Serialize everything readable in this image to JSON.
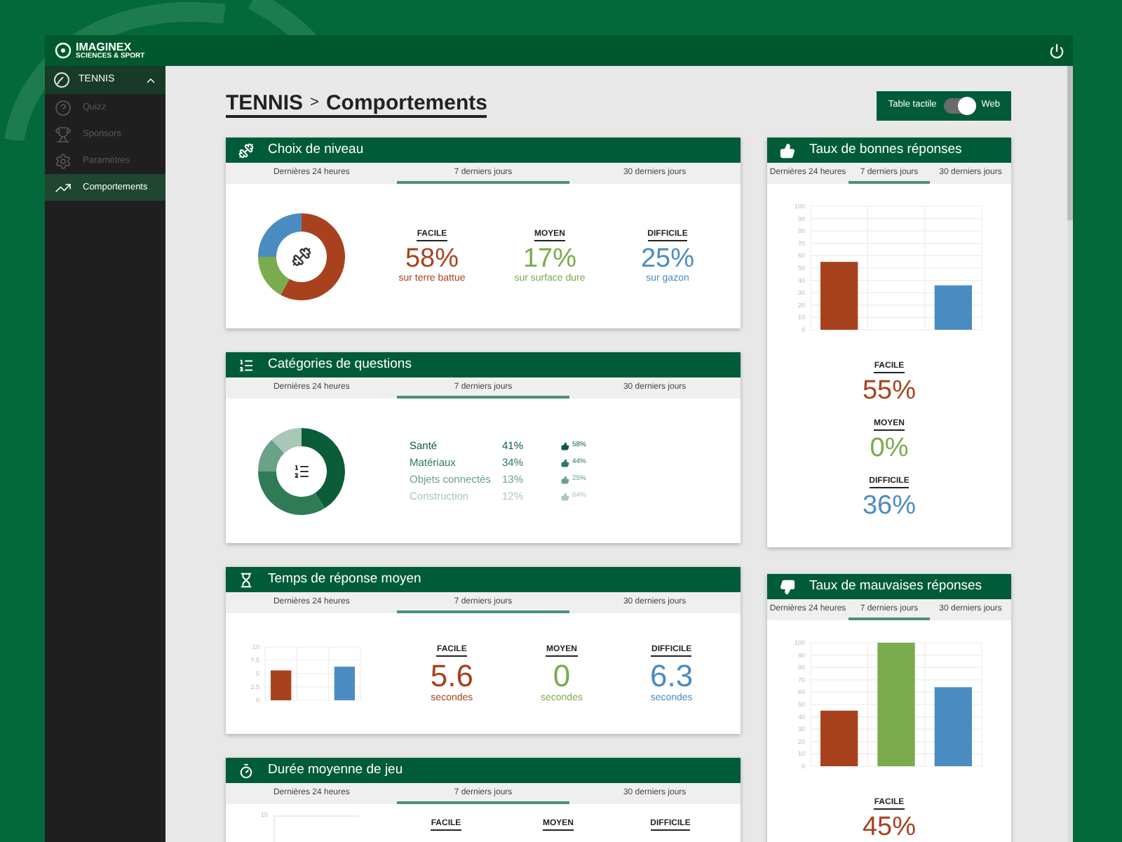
{
  "header": {
    "logo_name": "IMAGINEX",
    "logo_tagline": "SCIENCES & SPORT"
  },
  "sidebar": {
    "section": {
      "label": "TENNIS",
      "expanded": true
    },
    "items": [
      {
        "label": "Quizz",
        "selected": false
      },
      {
        "label": "Sponsors",
        "selected": false
      },
      {
        "label": "Paramètres",
        "selected": false
      },
      {
        "label": "Comportements",
        "selected": true
      }
    ]
  },
  "breadcrumb": {
    "section": "TENNIS",
    "separator": ">",
    "page": "Comportements"
  },
  "mode_toggle": {
    "left_label": "Table tactile",
    "right_label": "Web",
    "on": true
  },
  "left_cards": [
    {
      "kind": "levels_donut",
      "title": "Choix de niveau",
      "tabs": [
        {
          "label": "Dernières 24 heures",
          "selected": false
        },
        {
          "label": "7 derniers jours",
          "selected": true
        },
        {
          "label": "30 derniers jours",
          "selected": false
        }
      ],
      "chart_data": {
        "type": "donut",
        "values": [
          58,
          17,
          25
        ]
      },
      "stats": [
        {
          "label": "FACILE",
          "value": "58%",
          "caption": "sur terre battue",
          "color": "#a8421e"
        },
        {
          "label": "MOYEN",
          "value": "17%",
          "caption": "sur surface dure",
          "color": "#7aab4c"
        },
        {
          "label": "DIFFICILE",
          "value": "25%",
          "caption": "sur gazon",
          "color": "#4a8cc2"
        }
      ]
    },
    {
      "kind": "categories",
      "title": "Catégories de questions",
      "tabs": [
        {
          "label": "Dernières 24 heures",
          "selected": false
        },
        {
          "label": "7 derniers jours",
          "selected": true
        },
        {
          "label": "30 derniers jours",
          "selected": false
        }
      ],
      "chart_data": {
        "type": "donut",
        "values": [
          41,
          34,
          13,
          12
        ]
      },
      "items": [
        {
          "name": "Santé",
          "share": "41%",
          "success": "58%",
          "color": "#0b5c38"
        },
        {
          "name": "Matériaux",
          "share": "34%",
          "success": "44%",
          "color": "#2f7b57"
        },
        {
          "name": "Objets connectés",
          "share": "13%",
          "success": "25%",
          "color": "#6aa287"
        },
        {
          "name": "Construction",
          "share": "12%",
          "success": "64%",
          "color": "#a7c8b7"
        }
      ]
    },
    {
      "kind": "levels_bar",
      "title": "Temps de réponse moyen",
      "tabs": [
        {
          "label": "Dernières 24 heures",
          "selected": false
        },
        {
          "label": "7 derniers jours",
          "selected": true
        },
        {
          "label": "30 derniers jours",
          "selected": false
        }
      ],
      "chart_data": {
        "type": "bar",
        "values": [
          5.6,
          0,
          6.3
        ],
        "ylim": [
          0,
          10
        ],
        "yticks": [
          0,
          2.5,
          5,
          7.5,
          10
        ],
        "grid": true
      },
      "stats": [
        {
          "label": "FACILE",
          "value": "5.6",
          "caption": "secondes",
          "color": "#a8421e"
        },
        {
          "label": "MOYEN",
          "value": "0",
          "caption": "secondes",
          "color": "#7aab4c"
        },
        {
          "label": "DIFFICILE",
          "value": "6.3",
          "caption": "secondes",
          "color": "#4a8cc2"
        }
      ]
    },
    {
      "kind": "levels_partial",
      "title": "Durée moyenne de jeu",
      "tabs": [
        {
          "label": "Dernières 24 heures",
          "selected": false
        },
        {
          "label": "7 derniers jours",
          "selected": true
        },
        {
          "label": "30 derniers jours",
          "selected": false
        }
      ],
      "axis_label": "15",
      "stats": [
        {
          "label": "FACILE"
        },
        {
          "label": "MOYEN"
        },
        {
          "label": "DIFFICILE"
        }
      ]
    }
  ],
  "right_cards": [
    {
      "title": "Taux de bonnes réponses",
      "tabs": [
        {
          "label": "Dernières 24 heures",
          "selected": false
        },
        {
          "label": "7 derniers jours",
          "selected": true
        },
        {
          "label": "30 derniers jours",
          "selected": false
        }
      ],
      "chart_data": {
        "type": "bar",
        "values": [
          55,
          0,
          36
        ],
        "ylim": [
          0,
          100
        ],
        "yticks": [
          0,
          10,
          20,
          30,
          40,
          50,
          60,
          70,
          80,
          90,
          100
        ],
        "grid": true
      },
      "stats": [
        {
          "label": "FACILE",
          "value": "55%",
          "color": "#a8421e"
        },
        {
          "label": "MOYEN",
          "value": "0%",
          "color": "#7aab4c"
        },
        {
          "label": "DIFFICILE",
          "value": "36%",
          "color": "#4a8cc2"
        }
      ]
    },
    {
      "title": "Taux de mauvaises réponses",
      "tabs": [
        {
          "label": "Dernières 24 heures",
          "selected": false
        },
        {
          "label": "7 derniers jours",
          "selected": true
        },
        {
          "label": "30 derniers jours",
          "selected": false
        }
      ],
      "chart_data": {
        "type": "bar",
        "values": [
          45,
          100,
          64
        ],
        "ylim": [
          0,
          100
        ],
        "yticks": [
          0,
          10,
          20,
          30,
          40,
          50,
          60,
          70,
          80,
          90,
          100
        ],
        "grid": true
      },
      "stats": [
        {
          "label": "FACILE",
          "value": "45%",
          "color": "#a8421e"
        }
      ]
    }
  ]
}
